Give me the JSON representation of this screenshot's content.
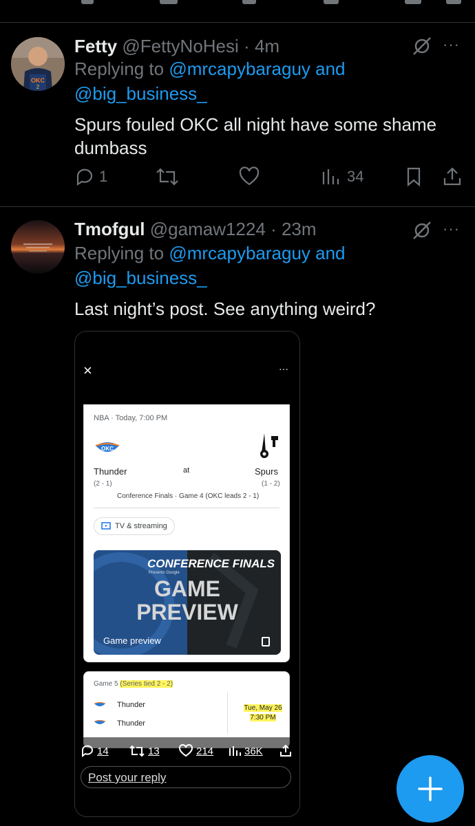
{
  "tweets": [
    {
      "name": "Fetty",
      "handle": "@FettyNoHesi",
      "dot": "·",
      "time": "4m",
      "replying_prefix": "Replying to",
      "replying_user1": "@mrcapybaraguy",
      "replying_and": "and",
      "replying_user2": "@big_business_",
      "text_line1": "Spurs fouled OKC all night have some shame",
      "text_line2": "dumbass",
      "replies": "1",
      "retweets": "",
      "likes": "",
      "views": "34"
    },
    {
      "name": "Tmofgul",
      "handle": "@gamaw1224",
      "dot": "·",
      "time": "23m",
      "replying_prefix": "Replying to",
      "replying_user1": "@mrcapybaraguy",
      "replying_and": "and",
      "replying_user2": "@big_business_",
      "text": "Last night’s post. See anything weird?"
    }
  ],
  "embedded": {
    "close": "×",
    "menu": "···",
    "league_time": "NBA · Today, 7:00 PM",
    "away_team": "Thunder",
    "away_record": "(2 - 1)",
    "at": "at",
    "home_team": "Spurs",
    "home_record": "(1 - 2)",
    "series_note": "Conference Finals · Game 4 (OKC leads 2 - 1)",
    "chip_label": "TV & streaming",
    "banner_conf": "CONFERENCE FINALS",
    "banner_presents": "Presents Google",
    "banner_line1": "GAME",
    "banner_line2": "PREVIEW",
    "banner_caption": "Game preview",
    "game5_prefix": "Game 5",
    "game5_series": "(Series tied 2 - 2)",
    "g5_team1": "Thunder",
    "g5_team2": "Thunder",
    "g5_date": "Tue, May 26",
    "g5_time": "7:30 PM",
    "ov_replies": "14",
    "ov_retweets": "13",
    "ov_likes": "214",
    "ov_views": "36K",
    "post_reply": "Post your reply"
  },
  "colors": {
    "accent": "#1d9bf0",
    "muted": "#71767b",
    "highlight": "#fff45c"
  },
  "icons": [
    "reply-icon",
    "retweet-icon",
    "like-icon",
    "views-icon",
    "bookmark-icon",
    "share-icon",
    "grok-icon",
    "more-icon",
    "plus-icon"
  ]
}
